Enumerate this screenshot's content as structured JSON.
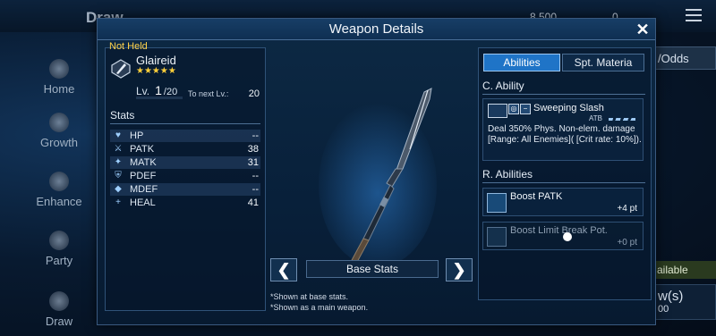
{
  "background": {
    "title": "Draw",
    "currency_1": "8,500",
    "currency_2": "0",
    "nav": [
      {
        "label": "Home"
      },
      {
        "label": "Growth"
      },
      {
        "label": "Enhance"
      },
      {
        "label": "Party"
      },
      {
        "label": "Draw"
      }
    ],
    "right_button": "/Odds",
    "right_available": "ailable",
    "right_draw": "w(s)",
    "right_draw_sub": "00"
  },
  "dialog": {
    "title": "Weapon Details",
    "close_label": "✕"
  },
  "weapon": {
    "status": "Not Held",
    "name": "Glaireid",
    "stars": "★★★★★",
    "level_label": "Lv.",
    "level": "1",
    "level_max": "/20",
    "next_label": "To next Lv.:",
    "next_value": "20"
  },
  "stats": {
    "label": "Stats",
    "rows": [
      {
        "icon": "♥",
        "name": "HP",
        "value": "--"
      },
      {
        "icon": "⚔",
        "name": "PATK",
        "value": "38"
      },
      {
        "icon": "✦",
        "name": "MATK",
        "value": "31"
      },
      {
        "icon": "⛨",
        "name": "PDEF",
        "value": "--"
      },
      {
        "icon": "◆",
        "name": "MDEF",
        "value": "--"
      },
      {
        "icon": "+",
        "name": "HEAL",
        "value": "41"
      }
    ]
  },
  "center": {
    "prev_label": "❮",
    "next_label": "❯",
    "base_stats_label": "Base Stats",
    "note_1": "*Shown at base stats.",
    "note_2": "*Shown as a main weapon."
  },
  "right": {
    "tabs": [
      {
        "label": "Abilities",
        "active": true
      },
      {
        "label": "Spt. Materia",
        "active": false
      }
    ],
    "c_ability_title": "C. Ability",
    "c_ability": {
      "name": "Sweeping Slash",
      "badge_1": "◎",
      "badge_2": "−",
      "atb_label": "ATB",
      "description": "Deal 350% Phys. Non-elem. damage [Range: All Enemies]( [Crit rate: 10%])."
    },
    "r_abilities_title": "R. Abilities",
    "r_abilities": [
      {
        "name": "Boost PATK",
        "points": "+4 pt"
      },
      {
        "name": "Boost Limit Break Pot.",
        "points": "+0 pt"
      }
    ]
  },
  "colors": {
    "accent": "#1f74c7",
    "gold": "#ffcf3a",
    "not_held": "#ffd24a"
  }
}
